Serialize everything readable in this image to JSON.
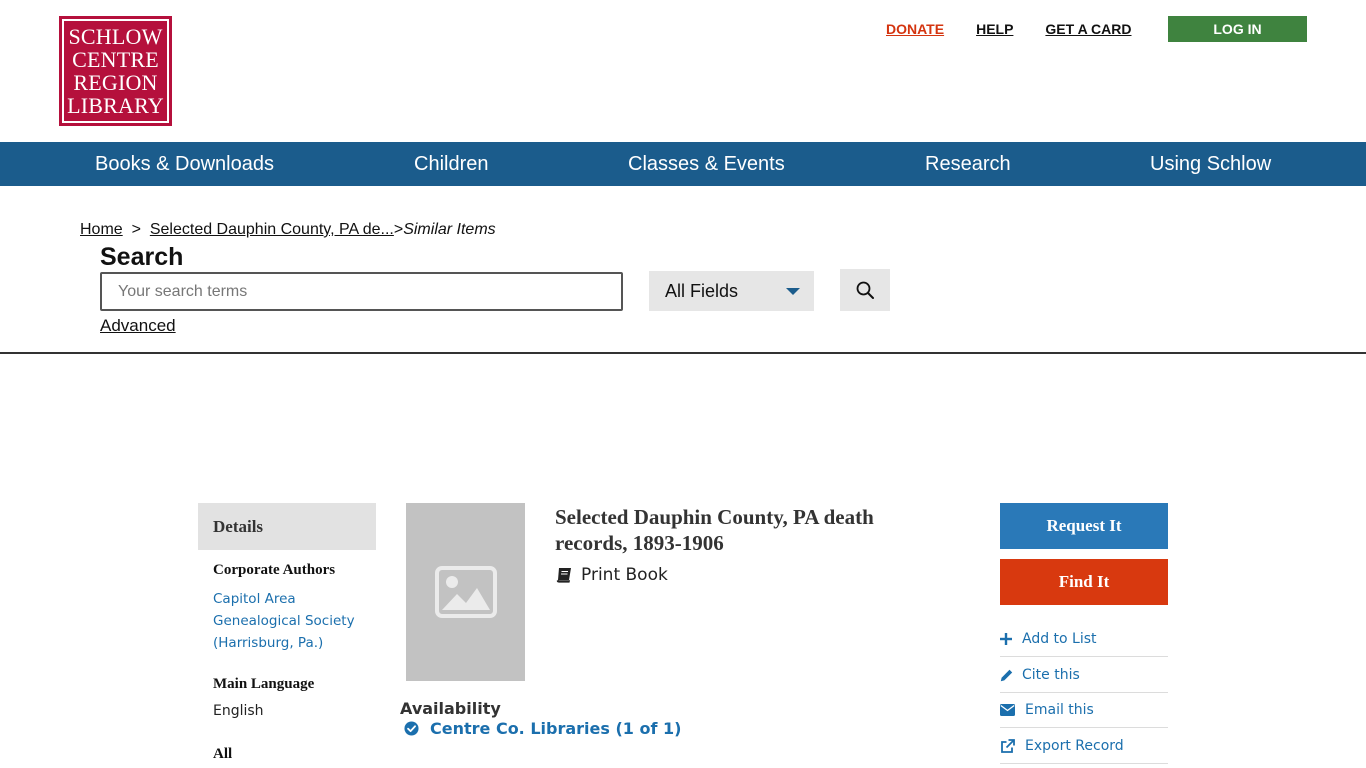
{
  "logo": {
    "lines": [
      "SCHLOW",
      "CENTRE",
      "REGION",
      "LIBRARY"
    ]
  },
  "top_links": {
    "donate": "DONATE",
    "help": "HELP",
    "get_card": "GET A CARD",
    "login": "LOG IN"
  },
  "nav": [
    "Books & Downloads",
    "Children",
    "Classes & Events",
    "Research",
    "Using Schlow"
  ],
  "breadcrumb": {
    "home": "Home",
    "separator": ">",
    "record": "Selected Dauphin County, PA de...",
    "current": "Similar Items"
  },
  "search": {
    "heading": "Search",
    "placeholder": "Your search terms",
    "field_selected": "All Fields",
    "advanced": "Advanced"
  },
  "sidebar": {
    "tab": "Details",
    "corporate_authors_heading": "Corporate Authors",
    "corporate_author": "Capitol Area Genealogical Society (Harrisburg, Pa.)",
    "main_language_heading": "Main Language",
    "main_language": "English",
    "all_heading": "All"
  },
  "record": {
    "title": "Selected Dauphin County, PA death records, 1893-1906",
    "format": "Print Book"
  },
  "availability": {
    "heading": "Availability",
    "item": "Centre Co. Libraries (1 of 1)"
  },
  "actions": {
    "request": "Request It",
    "find": "Find It",
    "add_to_list": "Add to List",
    "cite": "Cite this",
    "email": "Email this",
    "export": "Export Record"
  },
  "colors": {
    "brand": "#b5103c",
    "nav": "#1b5c8c",
    "login": "#3f833f",
    "request": "#2a79b8",
    "find": "#d8390f",
    "link": "#1b6fad"
  }
}
